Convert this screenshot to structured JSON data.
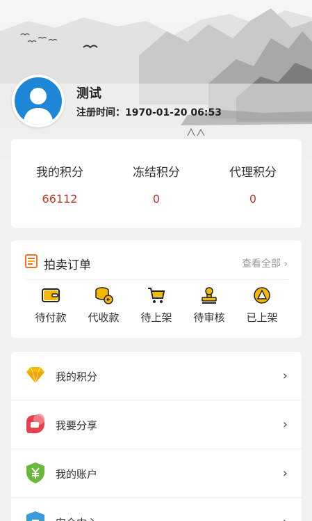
{
  "profile": {
    "username": "测试",
    "register_time": "注册时间：1970-01-20 06:53"
  },
  "points": [
    {
      "label": "我的积分",
      "value": "66112"
    },
    {
      "label": "冻结积分",
      "value": "0"
    },
    {
      "label": "代理积分",
      "value": "0"
    }
  ],
  "orders": {
    "title": "拍卖订单",
    "view_all": "查看全部",
    "items": [
      {
        "label": "待付款",
        "icon": "wallet-icon"
      },
      {
        "label": "代收款",
        "icon": "coins-icon"
      },
      {
        "label": "待上架",
        "icon": "cart-icon"
      },
      {
        "label": "待审核",
        "icon": "stamp-icon"
      },
      {
        "label": "已上架",
        "icon": "triangle-badge-icon"
      }
    ]
  },
  "menu": [
    {
      "label": "我的积分",
      "icon": "diamond-icon"
    },
    {
      "label": "我要分享",
      "icon": "share-icon"
    },
    {
      "label": "我的账户",
      "icon": "yen-shield-icon"
    },
    {
      "label": "安全中心",
      "icon": "security-icon"
    }
  ],
  "colors": {
    "accent_red": "#c0392b",
    "icon_yellow": "#f5b800",
    "avatar_blue": "#1e86d6",
    "share_red": "#e8404a",
    "account_green": "#6ab83c"
  }
}
